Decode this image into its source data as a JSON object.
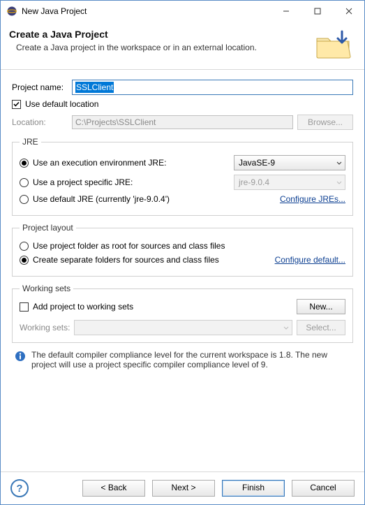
{
  "titlebar": {
    "title": "New Java Project"
  },
  "banner": {
    "title": "Create a Java Project",
    "subtitle": "Create a Java project in the workspace or in an external location."
  },
  "project": {
    "name_label": "Project name:",
    "name_value": "SSLClient",
    "use_default_label": "Use default location",
    "location_label": "Location:",
    "location_value": "C:\\Projects\\SSLClient",
    "browse_label": "Browse..."
  },
  "jre": {
    "legend": "JRE",
    "opt_env_label": "Use an execution environment JRE:",
    "env_value": "JavaSE-9",
    "opt_proj_label": "Use a project specific JRE:",
    "proj_value": "jre-9.0.4",
    "opt_default_label": "Use default JRE (currently 'jre-9.0.4')",
    "configure_link": "Configure JREs..."
  },
  "layout": {
    "legend": "Project layout",
    "opt_root_label": "Use project folder as root for sources and class files",
    "opt_sep_label": "Create separate folders for sources and class files",
    "configure_link": "Configure default..."
  },
  "ws": {
    "legend": "Working sets",
    "add_label": "Add project to working sets",
    "new_label": "New...",
    "sets_label": "Working sets:",
    "select_label": "Select..."
  },
  "info": {
    "text": "The default compiler compliance level for the current workspace is 1.8. The new project will use a project specific compiler compliance level of 9."
  },
  "footer": {
    "back": "< Back",
    "next": "Next >",
    "finish": "Finish",
    "cancel": "Cancel"
  }
}
